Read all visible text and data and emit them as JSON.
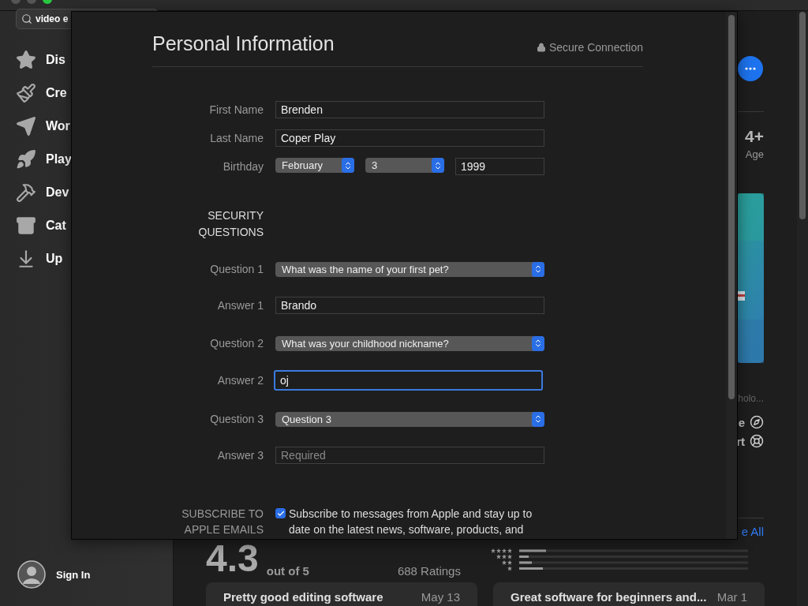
{
  "sidebar": {
    "search": {
      "value": "video e"
    },
    "items": [
      {
        "label": "Dis"
      },
      {
        "label": "Cre"
      },
      {
        "label": "Wor"
      },
      {
        "label": "Play"
      },
      {
        "label": "Dev"
      },
      {
        "label": "Cat"
      },
      {
        "label": "Up"
      }
    ],
    "account": {
      "label": "Sign In"
    }
  },
  "app_details": {
    "age": "4+",
    "age_label": "Age",
    "developer": "holo...",
    "links": [
      {
        "label": "e",
        "kind": "compass"
      },
      {
        "label": "rt",
        "kind": "support"
      }
    ],
    "see_all": "e All"
  },
  "ratings": {
    "score": "4.3",
    "out_of": "out of 5",
    "count": "688 Ratings"
  },
  "reviews": [
    {
      "title": "Pretty good editing software",
      "date": "May 13"
    },
    {
      "title": "Great software for beginners and...",
      "date": "Mar 1"
    }
  ],
  "sheet": {
    "title": "Personal Information",
    "secure": "Secure Connection",
    "rows": [
      {
        "kind": "text",
        "label": "First Name",
        "value": "Brenden",
        "focused": false
      },
      {
        "kind": "text",
        "label": "Last Name",
        "value": "Coper Play",
        "focused": false
      },
      {
        "kind": "date",
        "label": "Birthday",
        "month": "February",
        "day": "3",
        "year": "1999"
      },
      {
        "kind": "heading",
        "label": "SECURITY QUESTIONS"
      },
      {
        "kind": "select",
        "label": "Question 1",
        "value": "What was the name of your first pet?"
      },
      {
        "kind": "text",
        "label": "Answer 1",
        "value": "Brando",
        "focused": false
      },
      {
        "kind": "select",
        "label": "Question 2",
        "value": "What was your childhood nickname?"
      },
      {
        "kind": "text",
        "label": "Answer 2",
        "value": "oj",
        "focused": true
      },
      {
        "kind": "select",
        "label": "Question 3",
        "value": "Question 3"
      },
      {
        "kind": "text",
        "label": "Answer 3",
        "placeholder": "Required",
        "focused": false
      }
    ],
    "subscribe": {
      "label": "SUBSCRIBE TO APPLE EMAILS",
      "checked": true,
      "text": "Subscribe to messages from Apple and stay up to date on the latest news, software, products, and"
    }
  }
}
